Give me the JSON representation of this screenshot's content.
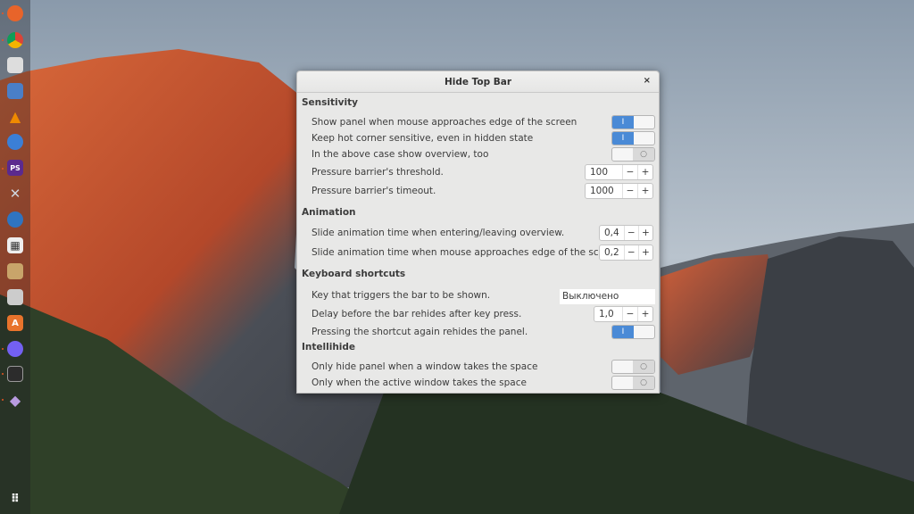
{
  "dock": {
    "items": [
      "Firefox",
      "Chrome",
      "Settings",
      "Files",
      "VLC",
      "Simplenote",
      "PhpStorm",
      "Tools",
      "Thunderbird",
      "Calculator",
      "Image viewer",
      "Installer",
      "Software",
      "Viber",
      "Terminal",
      "App"
    ],
    "apps_grid": "Show applications"
  },
  "dialog": {
    "title": "Hide Top Bar",
    "close": "×",
    "sections": {
      "sensitivity": {
        "title": "Sensitivity",
        "show_panel": {
          "label": "Show panel when mouse approaches edge of the screen",
          "on": true
        },
        "hot_corner": {
          "label": "Keep hot corner sensitive, even in hidden state",
          "on": true
        },
        "show_overview": {
          "label": "In the above case show overview, too",
          "on": false
        },
        "threshold": {
          "label": "Pressure barrier's threshold.",
          "value": "100"
        },
        "timeout": {
          "label": "Pressure barrier's timeout.",
          "value": "1000"
        }
      },
      "animation": {
        "title": "Animation",
        "overview_time": {
          "label": "Slide animation time when entering/leaving overview.",
          "value": "0,4"
        },
        "edge_time": {
          "label": "Slide animation time when mouse approaches edge of the screen.",
          "value": "0,2"
        }
      },
      "keyboard": {
        "title": "Keyboard shortcuts",
        "key": {
          "label": "Key that triggers the bar to be shown.",
          "value": "Выключено"
        },
        "delay": {
          "label": "Delay before the bar rehides after key press.",
          "value": "1,0"
        },
        "rehide": {
          "label": "Pressing the shortcut again rehides the panel.",
          "on": true
        }
      },
      "intellihide": {
        "title": "Intellihide",
        "window": {
          "label": "Only hide panel when a window takes the space",
          "on": false
        },
        "active": {
          "label": "Only when the active window takes the space",
          "on": false
        }
      }
    },
    "minus": "−",
    "plus": "+",
    "on_glyph": "I",
    "off_glyph": "○"
  }
}
